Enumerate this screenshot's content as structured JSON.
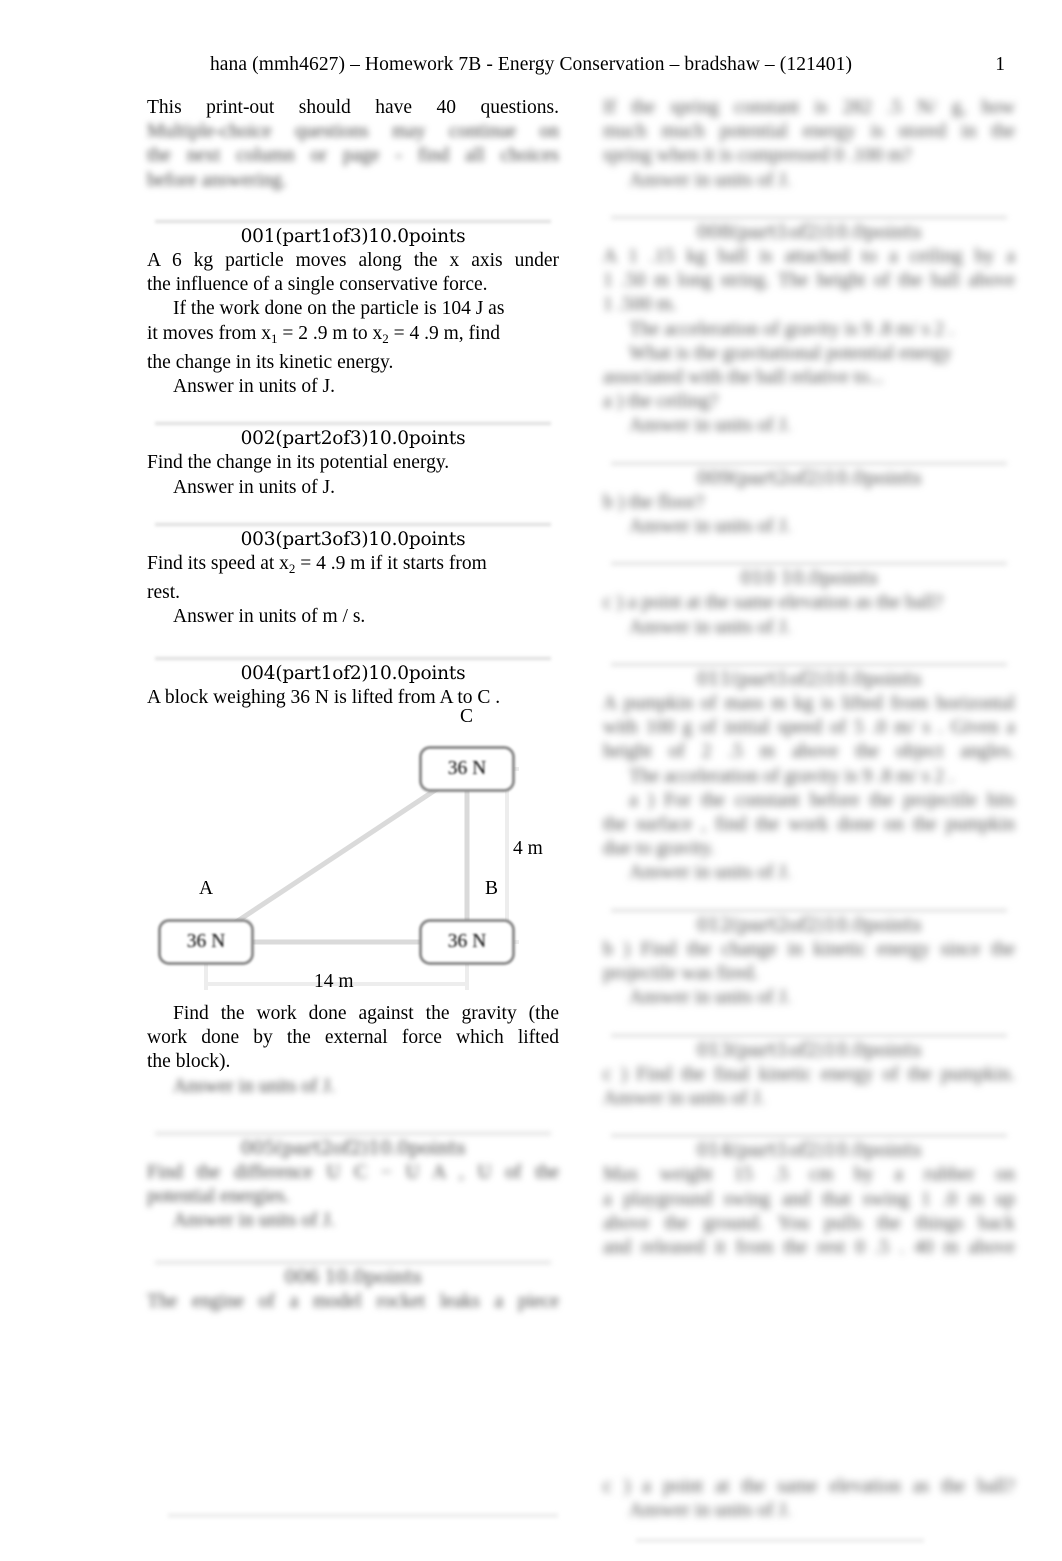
{
  "header": {
    "title": "hana (mmh4627) – Homework 7B - Energy Conservation – bradshaw – (121401)",
    "page_number": "1"
  },
  "left_column": {
    "intro": {
      "line1": "This   print-out   should   have   40   questions.",
      "blurred_line1": "Multiple-choice  questions  may  continue  on",
      "blurred_line2": "the  next  column  or  page  -  find  all  choices",
      "blurred_line3": "before answering."
    },
    "q001": {
      "heading": "001(part1of3)10.0points",
      "body_line1": "A 6 kg particle moves along the    x  axis under",
      "body_line2": "the influence of a single conservative force.",
      "body_line3": "If the work done on the particle is 104 J as",
      "body_line4_a": "it moves from  x",
      "body_line4_sub1": "1",
      "body_line4_b": " = 2 .9 m to  x",
      "body_line4_sub2": "2",
      "body_line4_c": " = 4 .9 m, find",
      "body_line5": "the change in its kinetic energy.",
      "answer_prompt": "Answer in units of J."
    },
    "q002": {
      "heading": "002(part2of3)10.0points",
      "body": "Find the change in its potential energy.",
      "answer_prompt": "Answer in units of J."
    },
    "q003": {
      "heading": "003(part3of3)10.0points",
      "body_a": "Find its speed at    x",
      "body_sub": "2",
      "body_b": " = 4 .9 m if it starts from",
      "body_line2": "rest.",
      "answer_prompt": "Answer in units of m  / s."
    },
    "q004": {
      "heading": "004(part1of2)10.0points",
      "body": "A block weighing 36 N is lifted from    A to C .",
      "figure": {
        "block_a_label": "36 N",
        "block_b_label": "36 N",
        "block_c_label": "36 N",
        "vertex_a": "A",
        "vertex_b": "B",
        "vertex_c": "C",
        "base_dimension": "14 m",
        "height_dimension": "4 m"
      },
      "question_line1": "Find the work done against the gravity (the",
      "question_line2": "work  done  by  the  external  force  which  lifted",
      "question_line3": "the block).",
      "answer_prompt_blurred": "Answer in units of J."
    },
    "q005_blurred": {
      "heading": "005(part2of2)10.0points",
      "line1": "Find  the  difference  U  C   −   U  A    ,    U  of the",
      "line2": "potential energies.",
      "answer_prompt": "Answer in units of J."
    },
    "q006_blurred": {
      "heading": "006      10.0points",
      "line1": "The  engine  of  a  model  rocket  leaks  a  piece"
    },
    "footer_rule": true
  },
  "right_column": {
    "blurred_blocks": [
      {
        "lines": [
          "If  the  spring  constant  is  282 .5 N/ g,  how",
          "much  much  potential  energy  is  stored  in  the",
          "spring when it is compressed 0 .100 m?",
          "Answer in units of J."
        ]
      },
      {
        "heading": "008(part1of2)10.0points",
        "lines": [
          "A  1 .15  kg  ball  is  attached  to  a  ceiling  by  a",
          "1 .50 m long string. The height of the ball above",
          "1 .500 m.",
          "The acceleration of gravity is 9 .8 m/ s 2  .",
          "What  is  the  gravitational  potential  energy",
          "associated with the ball relative to...",
          "a ) the ceiling?",
          "Answer in units of J."
        ]
      },
      {
        "heading": "009(part2of2)10.0points",
        "lines": [
          "b ) the floor?",
          "Answer in units of J."
        ]
      },
      {
        "heading": "010      10.0points",
        "lines": [
          "c ) a point at the same elevation as the ball?",
          "Answer in units of J."
        ]
      },
      {
        "heading": "011(part1of2)10.0points",
        "lines": [
          "A pumpkin of mass   m  kg is lifted from horizontal",
          "with  100 g of  initial  speed  of  5 .0   m/ s .  Given a",
          "height of 2 .5 m above the object angles.",
          "The acceleration of gravity is 9 .8 m/ s 2  .",
          "a ) For the constant before the projectile hits",
          "the surface , find the work done on the pumpkin",
          "due to gravity.",
          "Answer in units of J."
        ]
      },
      {
        "heading": "012(part2of2)10.0points",
        "lines": [
          "b ) Find the change in kinetic energy since the",
          "projectile was fired.",
          "Answer in units of J."
        ]
      },
      {
        "heading": "013(part1of2)10.0points",
        "lines": [
          "c ) Find the final kinetic energy of the pumpkin.",
          "Answer in units of J."
        ]
      },
      {
        "heading": "014(part1of2)10.0points",
        "lines": [
          "Max  weight  15 .5  cm  by  a  rubber  on",
          "a  playground  swing  and  that  swing  1 .0   m  up",
          "above  the  ground.  You  pulls  the  things  back",
          "and released it from the rest 0 .5   . 40 m above"
        ]
      }
    ],
    "footer_blurred": {
      "lines": [
        "c ) a point at the same elevation as the ball?",
        "Answer in units of J."
      ]
    }
  }
}
